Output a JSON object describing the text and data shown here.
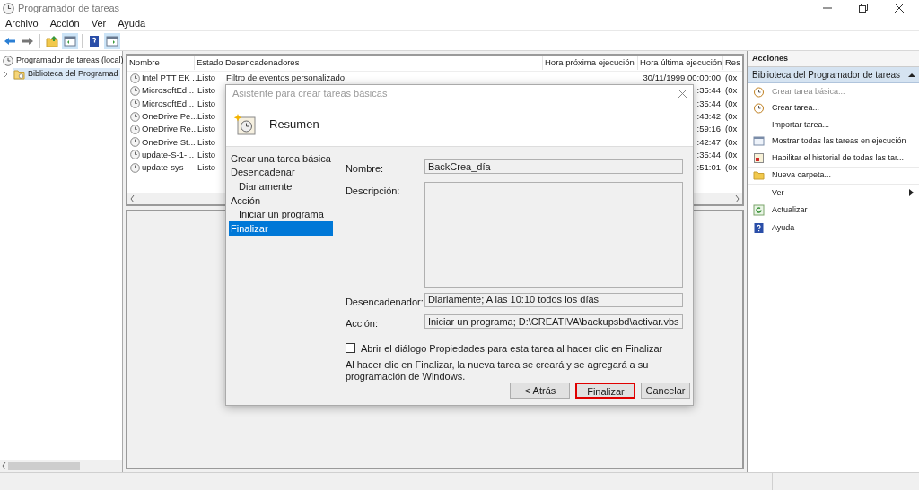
{
  "window": {
    "title": "Programador de tareas"
  },
  "menu": [
    "Archivo",
    "Acción",
    "Ver",
    "Ayuda"
  ],
  "tree": [
    {
      "label": "Programador de tareas (local)",
      "children": [
        {
          "label": "Biblioteca del Programad",
          "selected": true,
          "expanded": false
        }
      ]
    }
  ],
  "table": {
    "columns": [
      "Nombre",
      "Estado",
      "Desencadenadores",
      "Hora próxima ejecución",
      "Hora última ejecución",
      "Res"
    ],
    "rows": [
      {
        "name": "Intel PTT EK ...",
        "status": "Listo",
        "triggers": "Filtro de eventos personalizado",
        "last_run": "30/11/1999 00:00:00",
        "result": "(0x"
      },
      {
        "name": "MicrosoftEd...",
        "status": "Listo",
        "last_run": ":35:44",
        "result": "(0x"
      },
      {
        "name": "MicrosoftEd...",
        "status": "Listo",
        "last_run": ":35:44",
        "result": "(0x"
      },
      {
        "name": "OneDrive Pe...",
        "status": "Listo",
        "last_run": ":43:42",
        "result": "(0x"
      },
      {
        "name": "OneDrive Re...",
        "status": "Listo",
        "last_run": ":59:16",
        "result": "(0x"
      },
      {
        "name": "OneDrive St...",
        "status": "Listo",
        "last_run": ":42:47",
        "result": "(0x"
      },
      {
        "name": "update-S-1-...",
        "status": "Listo",
        "last_run": ":35:44",
        "result": "(0x"
      },
      {
        "name": "update-sys",
        "status": "Listo",
        "last_run": ":51:01",
        "result": "(0x"
      }
    ]
  },
  "dialog": {
    "title": "Asistente para crear tareas básicas",
    "heading": "Resumen",
    "steps": [
      {
        "label": "Crear una tarea básica",
        "selected": false
      },
      {
        "label": "Desencadenar",
        "selected": false,
        "children": [
          {
            "label": "Diariamente",
            "selected": false
          }
        ]
      },
      {
        "label": "Acción",
        "selected": false,
        "children": [
          {
            "label": "Iniciar un programa",
            "selected": false
          }
        ]
      },
      {
        "label": "Finalizar",
        "selected": true
      }
    ],
    "fields": [
      {
        "kind": "line",
        "label": "Nombre:",
        "value": "BackCrea_día"
      },
      {
        "kind": "area",
        "label": "Descripción:"
      },
      {
        "kind": "line",
        "label": "Desencadenador:",
        "value": "Diariamente; A las 10:10 todos los días"
      },
      {
        "kind": "line",
        "label": "Acción:",
        "value": "Iniciar un programa; D:\\CREATIVA\\backupsbd\\activar.vbs"
      }
    ],
    "checkbox": {
      "label": "Abrir el diálogo Propiedades para esta tarea al hacer clic en Finalizar",
      "checked": false
    },
    "note": "Al hacer clic en Finalizar, la nueva tarea se creará y se agregará a su programación de Windows.",
    "buttons": [
      {
        "label": "< Atrás",
        "highlighted": false
      },
      {
        "label": "Finalizar",
        "highlighted": true
      },
      {
        "label": "Cancelar",
        "highlighted": false
      }
    ]
  },
  "actions": {
    "title": "Acciones",
    "section": {
      "title": "Biblioteca del Programador de tareas",
      "expanded": true
    },
    "groups": [
      {
        "items": [
          {
            "label": "Crear tarea básica...",
            "kind": "action",
            "disabled": true
          },
          {
            "label": "Crear tarea...",
            "kind": "action",
            "disabled": false
          },
          {
            "label": "Importar tarea...",
            "kind": "action",
            "disabled": false
          },
          {
            "label": "Mostrar todas las tareas en ejecución",
            "kind": "action",
            "disabled": false
          },
          {
            "label": "Habilitar el historial de todas las tar...",
            "kind": "action",
            "disabled": false
          }
        ]
      },
      {
        "items": [
          {
            "label": "Nueva carpeta...",
            "kind": "action",
            "disabled": false
          }
        ]
      },
      {
        "items": [
          {
            "label": "Ver",
            "kind": "submenu",
            "disabled": false
          }
        ]
      },
      {
        "items": [
          {
            "label": "Actualizar",
            "kind": "action",
            "disabled": false
          }
        ]
      },
      {
        "items": [
          {
            "label": "Ayuda",
            "kind": "action",
            "disabled": false
          }
        ]
      }
    ]
  }
}
